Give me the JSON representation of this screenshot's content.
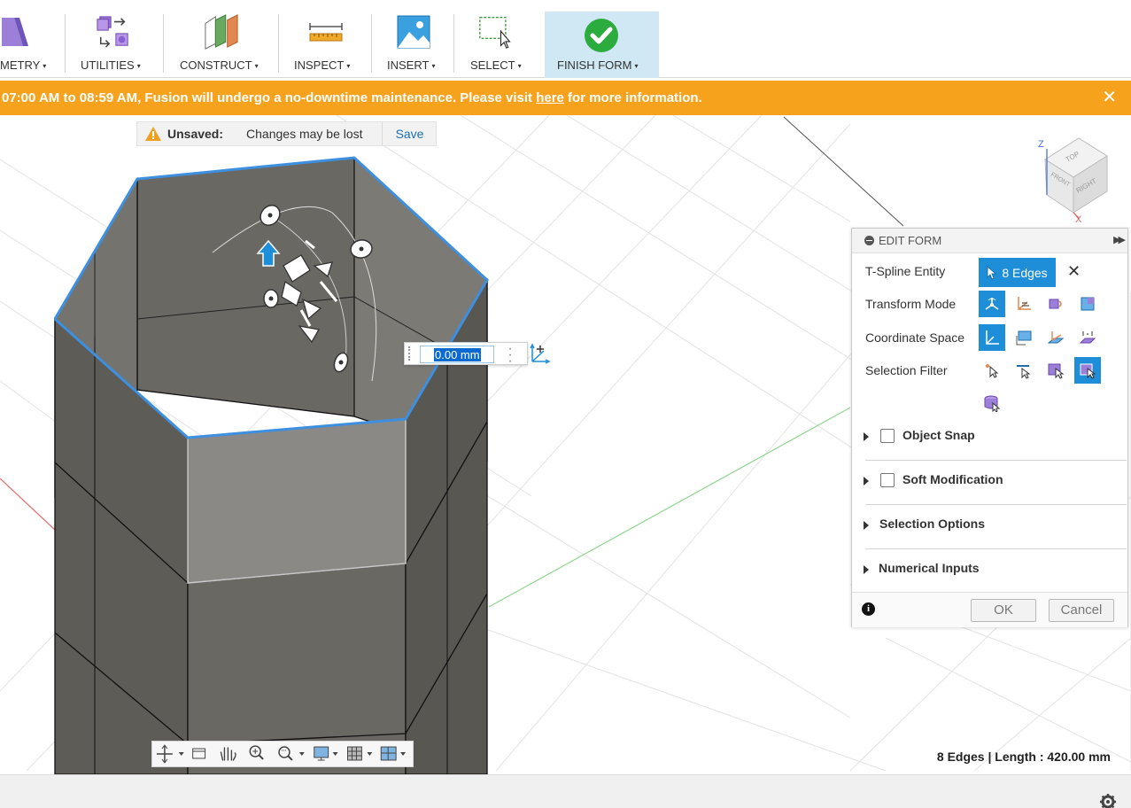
{
  "toolbar": {
    "groups": [
      {
        "label": "METRY",
        "icon": "geometry-icon"
      },
      {
        "label": "UTILITIES",
        "icon": "utilities-icon"
      },
      {
        "label": "CONSTRUCT",
        "icon": "construct-plane-icon"
      },
      {
        "label": "INSPECT",
        "icon": "measure-ruler-icon"
      },
      {
        "label": "INSERT",
        "icon": "insert-image-icon"
      },
      {
        "label": "SELECT",
        "icon": "select-box-icon"
      },
      {
        "label": "FINISH FORM",
        "icon": "green-checkmark-icon"
      }
    ],
    "caret": "▾"
  },
  "banner": {
    "text_before": "07:00 AM to 08:59 AM, Fusion will undergo a no-downtime maintenance. Please visit ",
    "link": "here",
    "text_after": " for more information.",
    "close": "✕",
    "color": "#f7a21d"
  },
  "unsaved": {
    "label": "Unsaved:",
    "message": "Changes may be lost",
    "save": "Save"
  },
  "value_input": {
    "value": "0.00 mm"
  },
  "viewcube": {
    "top": "TOP",
    "front": "FRONT",
    "right": "RIGHT",
    "axis_z": "Z",
    "axis_x": "X"
  },
  "edit_form": {
    "title": "EDIT FORM",
    "rows": {
      "tspline_entity": "T-Spline Entity",
      "transform_mode": "Transform Mode",
      "coordinate_space": "Coordinate Space",
      "selection_filter": "Selection Filter"
    },
    "entity_chip": "8 Edges",
    "sections": {
      "object_snap": "Object Snap",
      "soft_modification": "Soft Modification",
      "selection_options": "Selection Options",
      "numerical_inputs": "Numerical Inputs"
    },
    "ok": "OK",
    "cancel": "Cancel",
    "accent": "#1e8ed8"
  },
  "status": {
    "text": "8 Edges | Length : 420.00 mm"
  },
  "colors": {
    "selection_edge": "#3d8fe0",
    "body": "#5f5c57",
    "selected_face": "#8b8986"
  }
}
